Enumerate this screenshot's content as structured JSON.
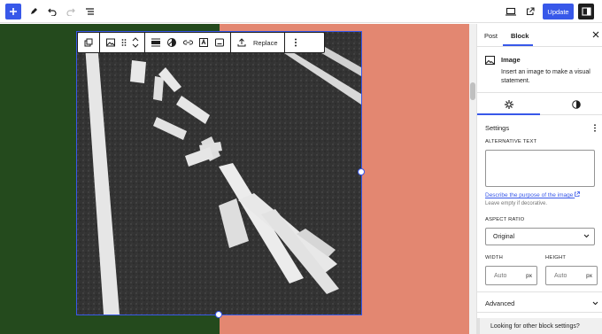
{
  "topbar": {
    "add_block_icon": "plus-icon",
    "tools_icon": "pencil-icon",
    "undo_icon": "undo-icon",
    "redo_icon": "redo-icon",
    "list_view_icon": "list-view-icon",
    "preview_icon": "desktop-icon",
    "view_post_icon": "external-link-icon",
    "update_label": "Update",
    "settings_icon": "sidebar-icon"
  },
  "canvas": {
    "left_color": "#244a1d",
    "right_color": "#e38771",
    "accent": "#3858e9"
  },
  "block_toolbar": {
    "replace_label": "Replace",
    "icons": [
      "duplicate-icon",
      "image-icon",
      "drag-handle-icon",
      "move-up-down-icon",
      "align-icon",
      "duotone-icon",
      "link-icon",
      "text-overlay-icon",
      "caption-icon",
      "upload-icon",
      "more-options-icon"
    ]
  },
  "sidebar": {
    "tabs": [
      "Post",
      "Block"
    ],
    "active_tab": "Block",
    "block_title": "Image",
    "block_description": "Insert an image to make a visual statement.",
    "settings_title": "Settings",
    "alt_text_label": "ALTERNATIVE TEXT",
    "alt_text_value": "",
    "describe_link": "Describe the purpose of the image",
    "alt_help": "Leave empty if decorative.",
    "aspect_ratio_label": "ASPECT RATIO",
    "aspect_ratio_value": "Original",
    "width_label": "WIDTH",
    "height_label": "HEIGHT",
    "width_placeholder": "Auto",
    "height_placeholder": "Auto",
    "unit": "px",
    "advanced_label": "Advanced",
    "notice_text": "Looking for other block settings?"
  }
}
